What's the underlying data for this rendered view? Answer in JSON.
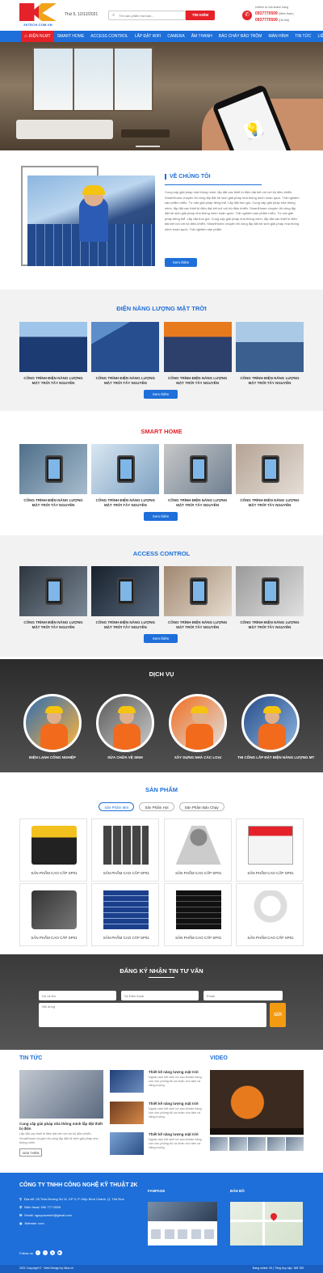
{
  "header": {
    "logo_sub": "2KTECH.COM.VN",
    "date": "Thứ 5, 12/12/2021",
    "search_placeholder": "Tìm sản phẩm mà bạn...",
    "search_button": "TÌM KIẾM",
    "hotline_label": "Hotline tư vấn khách hàng",
    "hotline_1": "0937770509",
    "hotline_1_note": "(Miền Nam)",
    "hotline_2": "0937770509",
    "hotline_2_note": "(Hà Nội)"
  },
  "nav": {
    "items": [
      "ĐIỆN NLMT",
      "SMART HOME",
      "ACCESS CONTROL",
      "LẮP ĐẶT WIFI",
      "CAMERA",
      "ÂM THANH",
      "BÁO CHÁY BÁO TRỘM",
      "MÀN HÌNH",
      "TIN TỨC",
      "LIÊN HỆ"
    ]
  },
  "about": {
    "title": "VỀ CHÚNG TÔI",
    "text": "Cung cấp giải pháp nhà thông minh, lắp đặt các thiết bị điện đạt kết nối với bộ điều khiển. SmartHome chuyên thi công lắp đặt hệ sinh giải pháp nhà thông minh hoàn quốc. Trải nghiệm sản phẩm miễu. Tư vấn giải pháp tiêng thể. Lắp đặt trọn gói. Cung cấp giải pháp nhà thông minh, lắp đặt các thiết bị điện đạt kết nối với bộ điều khiển. SmartHome chuyên thi công lắp đặt hệ sinh giải pháp nhà thông minh hoàn quốc. Trải nghiệm sản phẩm miễu. Tư vấn giải pháp tiêng thể. Lắp đặt trọn gói. Cung cấp giải pháp nhà thông minh, lắp đặt các thiết bị điện đạt kết nối với bộ điều khiển. SmartHome chuyên thi công lắp đặt hệ sinh giải pháp nhà thông minh hoàn quốc. Trải nghiệm sản phẩm",
    "button": "Xem thêm"
  },
  "solar": {
    "title": "ĐIỆN NĂNG LƯỢNG MẶT TRỜI",
    "items": [
      "CÔNG TRÌNH ĐIỆN NĂNG LƯỢNG MẶT TRỜI TÂY NGUYÊN",
      "CÔNG TRÌNH ĐIỆN NĂNG LƯỢNG MẶT TRỜI TÂY NGUYÊN",
      "CÔNG TRÌNH ĐIỆN NĂNG LƯỢNG MẶT TRỜI TÂY NGUYÊN",
      "CÔNG TRÌNH ĐIỆN NĂNG LƯỢNG MẶT TRỜI TÂY NGUYÊN"
    ],
    "button": "Xem thêm"
  },
  "smarthome": {
    "title": "SMART HOME",
    "items": [
      "CÔNG TRÌNH ĐIỆN NĂNG LƯỢNG MẶT TRỜI TÂY NGUYÊN",
      "CÔNG TRÌNH ĐIỆN NĂNG LƯỢNG MẶT TRỜI TÂY NGUYÊN",
      "CÔNG TRÌNH ĐIỆN NĂNG LƯỢNG MẶT TRỜI TÂY NGUYÊN",
      "CÔNG TRÌNH ĐIỆN NĂNG LƯỢNG MẶT TRỜI TÂY NGUYÊN"
    ],
    "button": "Xem thêm"
  },
  "access": {
    "title": "ACCESS CONTROL",
    "items": [
      "CÔNG TRÌNH ĐIỆN NĂNG LƯỢNG MẶT TRỜI TÂY NGUYÊN",
      "CÔNG TRÌNH ĐIỆN NĂNG LƯỢNG MẶT TRỜI TÂY NGUYÊN",
      "CÔNG TRÌNH ĐIỆN NĂNG LƯỢNG MẶT TRỜI TÂY NGUYÊN",
      "CÔNG TRÌNH ĐIỆN NĂNG LƯỢNG MẶT TRỜI TÂY NGUYÊN"
    ],
    "button": "Xem thêm"
  },
  "services": {
    "title": "DỊCH VỤ",
    "items": [
      "ĐIỆN LẠNH CÔNG NGHIỆP",
      "SỬA CHỮA VỆ SINH",
      "XÂY DỰNG NHÀ CÁC LOẠI",
      "THI CÔNG LẮP ĐẶT ĐIỆN NĂNG LƯỢNG MT"
    ]
  },
  "products": {
    "title": "SẢN PHẨM",
    "tabs": [
      "Sản Phẩm Mới",
      "Sản Phẩm Hot",
      "Sản Phẩm Bán Chạy"
    ],
    "items": [
      "SẢN PHẨM CAO CẤP SP01",
      "SẢN PHẨM CAO CẤP SP01",
      "SẢN PHẨM CAO CẤP SP01",
      "SẢN PHẨM CAO CẤP SP01",
      "SẢN PHẨM CAO CẤP SP01",
      "SẢN PHẨM CAO CẤP SP01",
      "SẢN PHẨM CAO CẤP SP01",
      "SẢN PHẨM CAO CẤP SP01"
    ]
  },
  "subscribe": {
    "title": "ĐĂNG KÝ NHẬN TIN TƯ VẤN",
    "name_placeholder": "Họ và tên",
    "phone_placeholder": "Số Điện thoại",
    "email_placeholder": "Email",
    "content_placeholder": "Nội dung",
    "send": "GỬI"
  },
  "news": {
    "title": "TIN TỨC",
    "big_title": "Cung cấp giải pháp nhà thông minh lắp đặt thiết bị điện",
    "big_desc": "Lắp đặt các thiết bị điện đạt kết nối với bộ điều khiển. SmartHome chuyên thi công lắp đặt hệ sinh giải pháp nhà thông minh.",
    "more": "XEM THÊM",
    "items": [
      {
        "title": "Thiết kế năng lượng mặt trời",
        "desc": "Ngoài cam kết sinh lợi sau khoản hàng còn cho phòng tủi cá nhân cho tấm và năng lượng."
      },
      {
        "title": "Thiết kế năng lượng mặt trời",
        "desc": "Ngoài cam kết sinh lợi sau khoản hàng còn cho phòng tủi cá nhân cho tấm và năng lượng."
      },
      {
        "title": "Thiết kế năng lượng mặt trời",
        "desc": "Ngoài cam kết sinh lợi sau khoản hàng còn cho phòng tủi cá nhân cho tấm và năng lượng."
      }
    ],
    "video_title": "VIDEO"
  },
  "footer": {
    "company": "CÔNG TY TNHH CÔNG NGHỆ KỸ THUẬT 2K",
    "address": "Địa chỉ: 25 Trần Đường Số 11, KP 3, P. Hiệp Bình Chánh, Q. Thủ Đức",
    "phone": "Điện thoại: 090 777 0509",
    "email": "Email: ngoquocminh@gmail.com",
    "website": "Website: com",
    "follow": "Follow us",
    "fanpage": "FANPAGE",
    "map": "BẢN ĐỒ",
    "copyright": "2021 Copyright © · Web Design by Nina.vn",
    "stats": "Đang online: 90 | Tổng truy cập: 188 789"
  }
}
